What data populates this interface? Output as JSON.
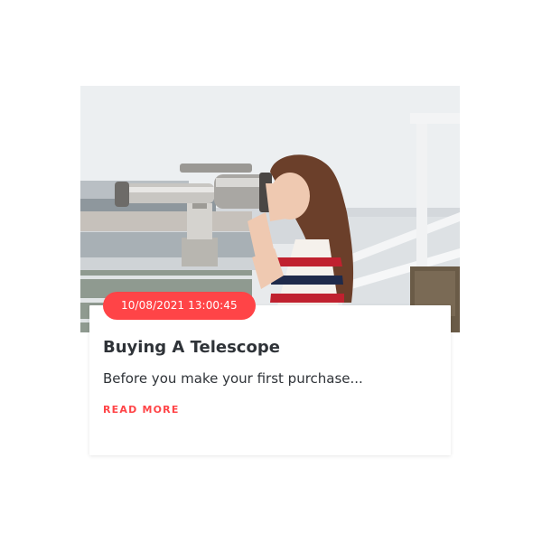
{
  "post": {
    "date": "10/08/2021 13:00:45",
    "title": "Buying A Telescope",
    "excerpt": "Before you make your first purchase...",
    "read_more_label": "READ MORE"
  },
  "hero": {
    "image": "woman-looking-through-coin-operated-binoculars-photo"
  },
  "colors": {
    "accent": "#ff4447",
    "text": "#2f3338",
    "card_bg": "#ffffff"
  }
}
